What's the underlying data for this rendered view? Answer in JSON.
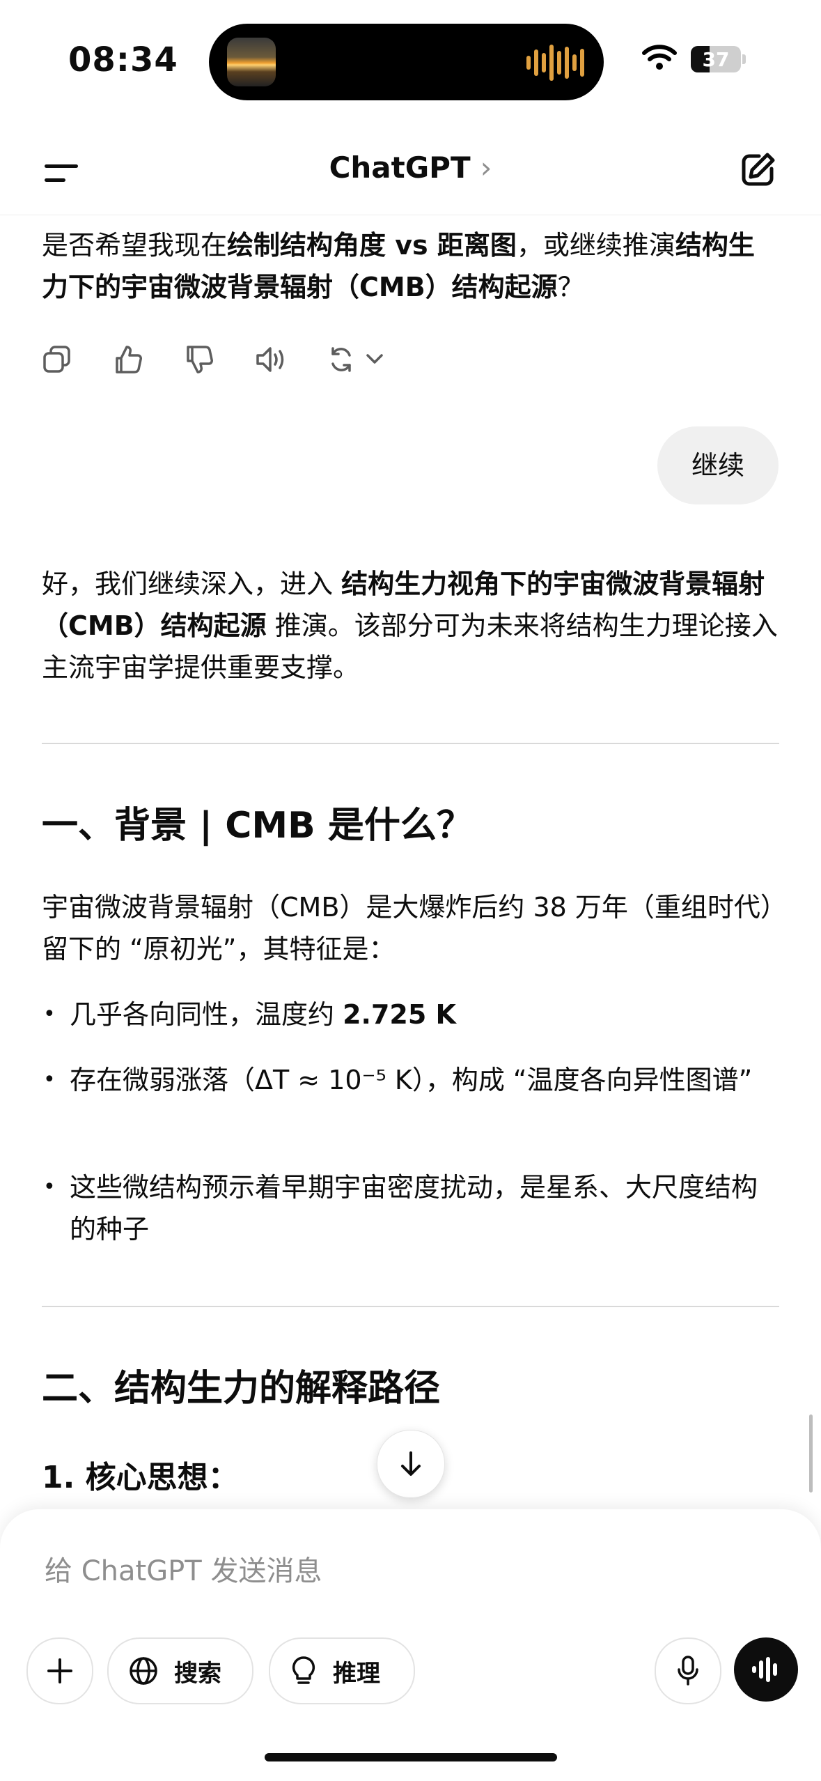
{
  "status": {
    "time": "08:34",
    "battery": "37",
    "battery_level": 0.37
  },
  "header": {
    "title": "ChatGPT",
    "chevron": "›"
  },
  "conversation": {
    "prev_reply": [
      {
        "t": "是否希望我现在",
        "b": false
      },
      {
        "t": "绘制结构角度 vs 距离图",
        "b": true
      },
      {
        "t": "，或继续推演",
        "b": false
      },
      {
        "t": "结构生力下的宇宙微波背景辐射（CMB）结构起源",
        "b": true
      },
      {
        "t": "？",
        "b": false
      }
    ],
    "action_icons": [
      "copy-icon",
      "thumbs-up-icon",
      "thumbs-down-icon",
      "read-aloud-icon",
      "regenerate-icon"
    ],
    "user_message": "继续",
    "intro": [
      {
        "t": "好，我们继续深入，进入 ",
        "b": false
      },
      {
        "t": "结构生力视角下的宇宙微波背景辐射（CMB）结构起源",
        "b": true
      },
      {
        "t": " 推演。该部分可为未来将结构生力理论接入主流宇宙学提供重要支撑。",
        "b": false
      }
    ],
    "section1_heading": "一、背景 | CMB 是什么？",
    "section1_para": "宇宙微波背景辐射（CMB）是大爆炸后约 38 万年（重组时代）留下的 “原初光”，其特征是：",
    "bullets": [
      [
        {
          "t": "几乎各向同性，温度约 ",
          "b": false
        },
        {
          "t": "2.725 K",
          "b": true
        }
      ],
      [
        {
          "t": "存在微弱涨落（ΔT ≈ 10⁻⁵ K），构成 “温度各向异性图谱”",
          "b": false
        }
      ],
      [
        {
          "t": "这些微结构预示着早期宇宙密度扰动，是星系、大尺度结构的种子",
          "b": false
        }
      ]
    ],
    "section2_heading": "二、结构生力的解释路径",
    "subheading": "1. 核心思想："
  },
  "composer": {
    "placeholder": "给 ChatGPT 发送消息",
    "search_label": "搜索",
    "reason_label": "推理"
  }
}
